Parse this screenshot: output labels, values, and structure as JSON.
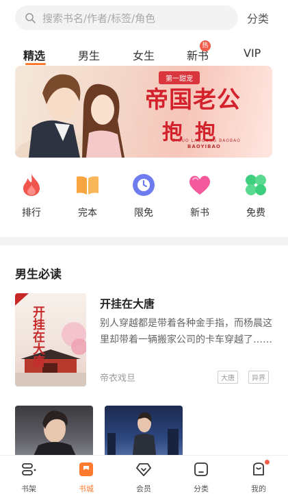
{
  "search": {
    "placeholder": "搜索书名/作者/标签/角色",
    "category_link": "分类"
  },
  "tabs": [
    {
      "label": "精选",
      "active": true
    },
    {
      "label": "男生"
    },
    {
      "label": "女生"
    },
    {
      "label": "新书",
      "badge": "热"
    },
    {
      "label": "VIP"
    }
  ],
  "banner": {
    "ribbon": "第一甜宠",
    "title_line1": "帝国老公",
    "title_line2": "抱抱",
    "subtitle": "ZIGUO LAOGONG BAOBAO",
    "author": "BAOYIBAO"
  },
  "quick_links": [
    {
      "label": "排行",
      "icon": "flame-icon",
      "color": "#f0564e"
    },
    {
      "label": "完本",
      "icon": "open-book-icon",
      "color": "#f6a540"
    },
    {
      "label": "限免",
      "icon": "clock-icon",
      "color": "#6f7cf0"
    },
    {
      "label": "新书",
      "icon": "heart-icon",
      "color": "#f25a9b"
    },
    {
      "label": "免费",
      "icon": "clover-icon",
      "color": "#3dcf7e"
    }
  ],
  "section": {
    "title": "男生必读",
    "book": {
      "cover_title": "开挂在大唐",
      "title": "开挂在大唐",
      "description": "别人穿越都是带着各种金手指，而杨晨这里却带着一辆搬家公司的卡车穿越了……",
      "author": "帝衣戏旦",
      "tags": [
        "大唐",
        "异界"
      ]
    }
  },
  "bottom_nav": [
    {
      "label": "书架",
      "icon": "bookshelf-icon"
    },
    {
      "label": "书城",
      "icon": "bookstore-icon",
      "active": true
    },
    {
      "label": "会员",
      "icon": "diamond-icon"
    },
    {
      "label": "分类",
      "icon": "category-icon"
    },
    {
      "label": "我的",
      "icon": "profile-icon",
      "dot": true
    }
  ],
  "colors": {
    "accent": "#ff7a2e",
    "badge": "#f25c4a"
  }
}
